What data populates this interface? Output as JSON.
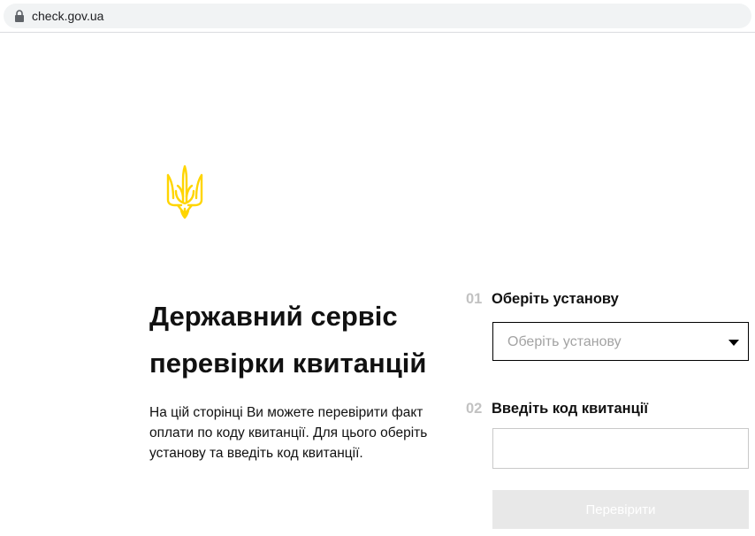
{
  "browser": {
    "url": "check.gov.ua",
    "lock_icon": "lock-icon"
  },
  "brand": {
    "emblem_icon": "ukraine-trident-icon",
    "emblem_color": "#FFD500"
  },
  "intro": {
    "title_line1": "Державний сервіс",
    "title_line2": "перевірки квитанцій",
    "description": "На цій сторінці Ви можете перевірити факт оплати по коду квитанції. Для цього оберіть установу та введіть код квитанції."
  },
  "form": {
    "step1": {
      "number": "01",
      "label": "Оберіть установу",
      "select_placeholder": "Оберіть установу"
    },
    "step2": {
      "number": "02",
      "label": "Введіть код квитанції",
      "input_value": ""
    },
    "submit_label": "Перевірити",
    "submit_bg": "#E8E8E8"
  }
}
